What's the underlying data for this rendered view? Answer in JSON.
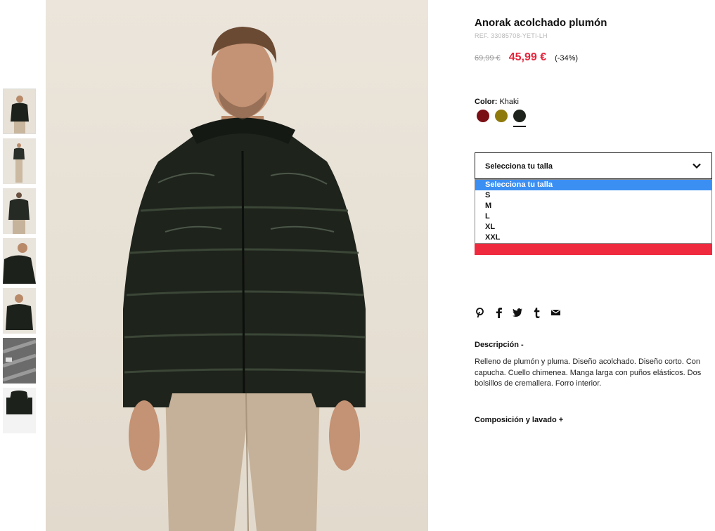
{
  "product": {
    "title": "Anorak acolchado plumón",
    "ref": "REF. 33085708-YETI-LH",
    "old_price": "69,99 €",
    "new_price": "45,99 €",
    "discount": "(-34%)"
  },
  "color": {
    "label": "Color:",
    "value": "Khaki",
    "swatches": [
      {
        "name": "burgundy",
        "hex": "#7a0f16"
      },
      {
        "name": "mustard",
        "hex": "#8f7a0c"
      },
      {
        "name": "khaki",
        "hex": "#1e231c",
        "selected": true
      }
    ]
  },
  "size_select": {
    "label": "Selecciona tu talla",
    "options": [
      "Selecciona tu talla",
      "S",
      "M",
      "L",
      "XL",
      "XXL"
    ],
    "highlighted_index": 0
  },
  "add_button": {
    "color": "#ef2a3f"
  },
  "social": [
    "pinterest-icon",
    "facebook-icon",
    "twitter-icon",
    "tumblr-icon",
    "email-icon"
  ],
  "description": {
    "title": "Descripción -",
    "text": "Relleno de plumón y pluma. Diseño acolchado. Diseño corto. Con capucha. Cuello chimenea. Manga larga con puños elásticos. Dos bolsillos de cremallera. Forro interior."
  },
  "composition": {
    "title": "Composición y lavado +"
  },
  "thumbnails": 7,
  "colors": {
    "accent": "#e5243b",
    "highlight": "#3b8ff3"
  }
}
